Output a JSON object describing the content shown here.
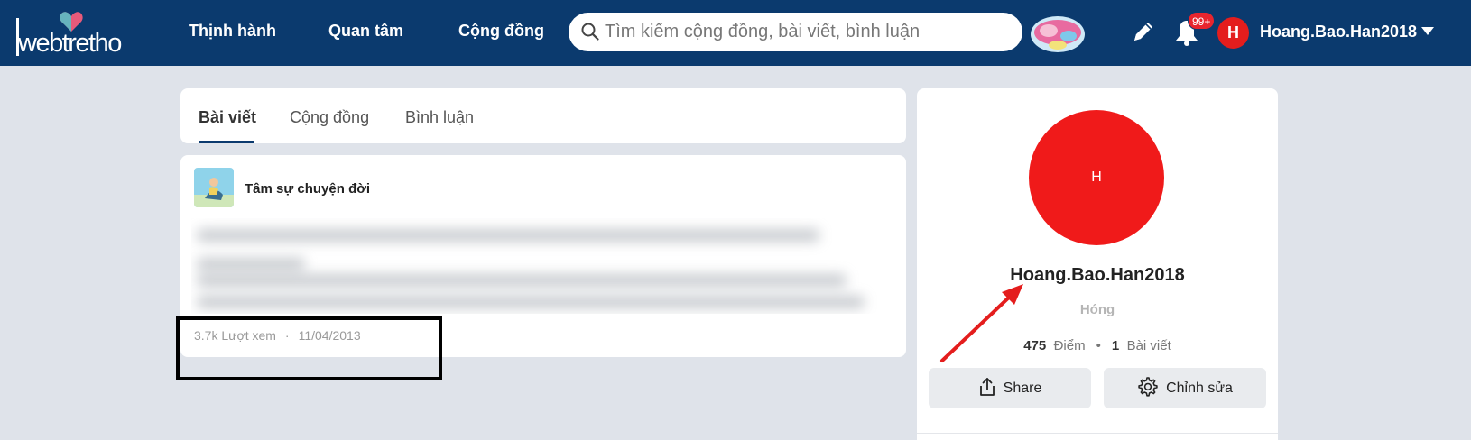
{
  "header": {
    "logo_text": "webtretho",
    "nav": [
      "Thịnh hành",
      "Quan tâm",
      "Cộng đồng"
    ],
    "search_placeholder": "Tìm kiếm cộng đồng, bài viết, bình luận",
    "notification_badge": "99+",
    "user_initial": "H",
    "username": "Hoang.Bao.Han2018",
    "icons": [
      "pencil-icon",
      "bell-icon",
      "search-icon",
      "chevron-down-icon"
    ]
  },
  "tabs": {
    "items": [
      "Bài viết",
      "Cộng đồng",
      "Bình luận"
    ],
    "active": "Bài viết"
  },
  "post": {
    "community": "Tâm sự chuyện đời",
    "views": "3.7k Lượt xem",
    "separator": "·",
    "date": "11/04/2013"
  },
  "profile": {
    "avatar_initial": "H",
    "name": "Hoang.Bao.Han2018",
    "title": "Hóng",
    "points_value": "475",
    "points_label": "Điểm",
    "stats_separator": "•",
    "posts_value": "1",
    "posts_label": "Bài viết",
    "share_label": "Share",
    "edit_label": "Chỉnh sửa"
  },
  "colors": {
    "header_bg": "#0b3a6e",
    "avatar_red": "#f01a1a",
    "badge_red": "#e8252e",
    "page_bg": "#dfe3ea"
  }
}
